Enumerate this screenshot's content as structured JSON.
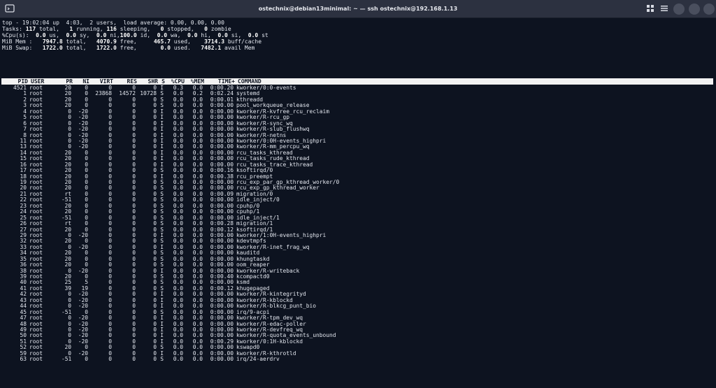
{
  "window": {
    "title": "ostechnix@debian13minimal: ~ — ssh ostechnix@192.168.1.13",
    "icons": [
      "terminal-icon",
      "grid-icon",
      "menu-icon",
      "minimize-icon",
      "maximize-icon",
      "close-icon"
    ]
  },
  "summary": {
    "uptime": "top - 19:02:04 up  4:03,  2 users,  load average: 0.00, 0.00, 0.00",
    "tasks": {
      "label": "Tasks:",
      "total": "117",
      "total_l": "total,",
      "running": "1",
      "running_l": "running,",
      "sleeping": "116",
      "sleeping_l": "sleeping,",
      "stopped": "0",
      "stopped_l": "stopped,",
      "zombie": "0",
      "zombie_l": "zombie"
    },
    "cpu": {
      "label": "%Cpu(s):",
      "us": "0.0",
      "us_l": "us,",
      "sy": "0.0",
      "sy_l": "sy,",
      "ni": "0.0",
      "ni_l": "ni,",
      "id": "100.0",
      "id_l": "id,",
      "wa": "0.0",
      "wa_l": "wa,",
      "hi": "0.0",
      "hi_l": "hi,",
      "si": "0.0",
      "si_l": "si,",
      "st": "0.0",
      "st_l": "st"
    },
    "mem": {
      "label": "MiB Mem :",
      "total": "7947.8",
      "total_l": "total,",
      "free": "4070.9",
      "free_l": "free,",
      "used": "465.7",
      "used_l": "used,",
      "buff": "3714.3",
      "buff_l": "buff/cache"
    },
    "swap": {
      "label": "MiB Swap:",
      "total": "1722.0",
      "total_l": "total,",
      "free": "1722.0",
      "free_l": "free,",
      "used": "0.0",
      "used_l": "used.",
      "avail": "7482.1",
      "avail_l": "avail Mem"
    }
  },
  "columns": [
    "PID",
    "USER",
    "PR",
    "NI",
    "VIRT",
    "RES",
    "SHR",
    "S",
    "%CPU",
    "%MEM",
    "TIME+",
    "COMMAND"
  ],
  "processes": [
    [
      "4521",
      "root",
      "20",
      "0",
      "0",
      "0",
      "0",
      "I",
      "0.3",
      "0.0",
      "0:00.20",
      "kworker/0:0-events"
    ],
    [
      "1",
      "root",
      "20",
      "0",
      "23868",
      "14572",
      "10728",
      "S",
      "0.0",
      "0.2",
      "0:02.24",
      "systemd"
    ],
    [
      "2",
      "root",
      "20",
      "0",
      "0",
      "0",
      "0",
      "S",
      "0.0",
      "0.0",
      "0:00.01",
      "kthreadd"
    ],
    [
      "3",
      "root",
      "20",
      "0",
      "0",
      "0",
      "0",
      "S",
      "0.0",
      "0.0",
      "0:00.00",
      "pool_workqueue_release"
    ],
    [
      "4",
      "root",
      "0",
      "-20",
      "0",
      "0",
      "0",
      "I",
      "0.0",
      "0.0",
      "0:00.00",
      "kworker/R-kvfree_rcu_reclaim"
    ],
    [
      "5",
      "root",
      "0",
      "-20",
      "0",
      "0",
      "0",
      "I",
      "0.0",
      "0.0",
      "0:00.00",
      "kworker/R-rcu_gp"
    ],
    [
      "6",
      "root",
      "0",
      "-20",
      "0",
      "0",
      "0",
      "I",
      "0.0",
      "0.0",
      "0:00.00",
      "kworker/R-sync_wq"
    ],
    [
      "7",
      "root",
      "0",
      "-20",
      "0",
      "0",
      "0",
      "I",
      "0.0",
      "0.0",
      "0:00.00",
      "kworker/R-slub_flushwq"
    ],
    [
      "8",
      "root",
      "0",
      "-20",
      "0",
      "0",
      "0",
      "I",
      "0.0",
      "0.0",
      "0:00.00",
      "kworker/R-netns"
    ],
    [
      "11",
      "root",
      "0",
      "-20",
      "0",
      "0",
      "0",
      "I",
      "0.0",
      "0.0",
      "0:00.00",
      "kworker/0:0H-events_highpri"
    ],
    [
      "13",
      "root",
      "0",
      "-20",
      "0",
      "0",
      "0",
      "I",
      "0.0",
      "0.0",
      "0:00.00",
      "kworker/R-mm_percpu_wq"
    ],
    [
      "14",
      "root",
      "20",
      "0",
      "0",
      "0",
      "0",
      "I",
      "0.0",
      "0.0",
      "0:00.00",
      "rcu_tasks_kthread"
    ],
    [
      "15",
      "root",
      "20",
      "0",
      "0",
      "0",
      "0",
      "I",
      "0.0",
      "0.0",
      "0:00.00",
      "rcu_tasks_rude_kthread"
    ],
    [
      "16",
      "root",
      "20",
      "0",
      "0",
      "0",
      "0",
      "I",
      "0.0",
      "0.0",
      "0:00.00",
      "rcu_tasks_trace_kthread"
    ],
    [
      "17",
      "root",
      "20",
      "0",
      "0",
      "0",
      "0",
      "S",
      "0.0",
      "0.0",
      "0:00.16",
      "ksoftirqd/0"
    ],
    [
      "18",
      "root",
      "20",
      "0",
      "0",
      "0",
      "0",
      "I",
      "0.0",
      "0.0",
      "0:00.38",
      "rcu_preempt"
    ],
    [
      "19",
      "root",
      "20",
      "0",
      "0",
      "0",
      "0",
      "S",
      "0.0",
      "0.0",
      "0:00.00",
      "rcu_exp_par_gp_kthread_worker/0"
    ],
    [
      "20",
      "root",
      "20",
      "0",
      "0",
      "0",
      "0",
      "S",
      "0.0",
      "0.0",
      "0:00.00",
      "rcu_exp_gp_kthread_worker"
    ],
    [
      "21",
      "root",
      "rt",
      "0",
      "0",
      "0",
      "0",
      "S",
      "0.0",
      "0.0",
      "0:00.09",
      "migration/0"
    ],
    [
      "22",
      "root",
      "-51",
      "0",
      "0",
      "0",
      "0",
      "S",
      "0.0",
      "0.0",
      "0:00.00",
      "idle_inject/0"
    ],
    [
      "23",
      "root",
      "20",
      "0",
      "0",
      "0",
      "0",
      "S",
      "0.0",
      "0.0",
      "0:00.00",
      "cpuhp/0"
    ],
    [
      "24",
      "root",
      "20",
      "0",
      "0",
      "0",
      "0",
      "S",
      "0.0",
      "0.0",
      "0:00.00",
      "cpuhp/1"
    ],
    [
      "25",
      "root",
      "-51",
      "0",
      "0",
      "0",
      "0",
      "S",
      "0.0",
      "0.0",
      "0:00.00",
      "idle_inject/1"
    ],
    [
      "26",
      "root",
      "rt",
      "0",
      "0",
      "0",
      "0",
      "S",
      "0.0",
      "0.0",
      "0:00.28",
      "migration/1"
    ],
    [
      "27",
      "root",
      "20",
      "0",
      "0",
      "0",
      "0",
      "S",
      "0.0",
      "0.0",
      "0:00.12",
      "ksoftirqd/1"
    ],
    [
      "29",
      "root",
      "0",
      "-20",
      "0",
      "0",
      "0",
      "I",
      "0.0",
      "0.0",
      "0:00.00",
      "kworker/1:0H-events_highpri"
    ],
    [
      "32",
      "root",
      "20",
      "0",
      "0",
      "0",
      "0",
      "S",
      "0.0",
      "0.0",
      "0:00.00",
      "kdevtmpfs"
    ],
    [
      "33",
      "root",
      "0",
      "-20",
      "0",
      "0",
      "0",
      "I",
      "0.0",
      "0.0",
      "0:00.00",
      "kworker/R-inet_frag_wq"
    ],
    [
      "34",
      "root",
      "20",
      "0",
      "0",
      "0",
      "0",
      "S",
      "0.0",
      "0.0",
      "0:00.00",
      "kauditd"
    ],
    [
      "35",
      "root",
      "20",
      "0",
      "0",
      "0",
      "0",
      "S",
      "0.0",
      "0.0",
      "0:00.00",
      "khungtaskd"
    ],
    [
      "36",
      "root",
      "20",
      "0",
      "0",
      "0",
      "0",
      "S",
      "0.0",
      "0.0",
      "0:00.00",
      "oom_reaper"
    ],
    [
      "38",
      "root",
      "0",
      "-20",
      "0",
      "0",
      "0",
      "I",
      "0.0",
      "0.0",
      "0:00.00",
      "kworker/R-writeback"
    ],
    [
      "39",
      "root",
      "20",
      "0",
      "0",
      "0",
      "0",
      "S",
      "0.0",
      "0.0",
      "0:00.40",
      "kcompactd0"
    ],
    [
      "40",
      "root",
      "25",
      "5",
      "0",
      "0",
      "0",
      "S",
      "0.0",
      "0.0",
      "0:00.00",
      "ksmd"
    ],
    [
      "41",
      "root",
      "39",
      "19",
      "0",
      "0",
      "0",
      "S",
      "0.0",
      "0.0",
      "0:00.12",
      "khugepaged"
    ],
    [
      "42",
      "root",
      "0",
      "-20",
      "0",
      "0",
      "0",
      "I",
      "0.0",
      "0.0",
      "0:00.00",
      "kworker/R-kintegrityd"
    ],
    [
      "43",
      "root",
      "0",
      "-20",
      "0",
      "0",
      "0",
      "I",
      "0.0",
      "0.0",
      "0:00.00",
      "kworker/R-kblockd"
    ],
    [
      "44",
      "root",
      "0",
      "-20",
      "0",
      "0",
      "0",
      "I",
      "0.0",
      "0.0",
      "0:00.00",
      "kworker/R-blkcg_punt_bio"
    ],
    [
      "45",
      "root",
      "-51",
      "0",
      "0",
      "0",
      "0",
      "S",
      "0.0",
      "0.0",
      "0:00.00",
      "irq/9-acpi"
    ],
    [
      "47",
      "root",
      "0",
      "-20",
      "0",
      "0",
      "0",
      "I",
      "0.0",
      "0.0",
      "0:00.00",
      "kworker/R-tpm_dev_wq"
    ],
    [
      "48",
      "root",
      "0",
      "-20",
      "0",
      "0",
      "0",
      "I",
      "0.0",
      "0.0",
      "0:00.00",
      "kworker/R-edac-poller"
    ],
    [
      "49",
      "root",
      "0",
      "-20",
      "0",
      "0",
      "0",
      "I",
      "0.0",
      "0.0",
      "0:00.00",
      "kworker/R-devfreq_wq"
    ],
    [
      "50",
      "root",
      "0",
      "-20",
      "0",
      "0",
      "0",
      "I",
      "0.0",
      "0.0",
      "0:00.00",
      "kworker/R-quota_events_unbound"
    ],
    [
      "51",
      "root",
      "0",
      "-20",
      "0",
      "0",
      "0",
      "I",
      "0.0",
      "0.0",
      "0:00.29",
      "kworker/0:1H-kblockd"
    ],
    [
      "52",
      "root",
      "20",
      "0",
      "0",
      "0",
      "0",
      "S",
      "0.0",
      "0.0",
      "0:00.00",
      "kswapd0"
    ],
    [
      "59",
      "root",
      "0",
      "-20",
      "0",
      "0",
      "0",
      "I",
      "0.0",
      "0.0",
      "0:00.00",
      "kworker/R-kthrotld"
    ],
    [
      "63",
      "root",
      "-51",
      "0",
      "0",
      "0",
      "0",
      "S",
      "0.0",
      "0.0",
      "0:00.00",
      "irq/24-aerdrv"
    ]
  ]
}
